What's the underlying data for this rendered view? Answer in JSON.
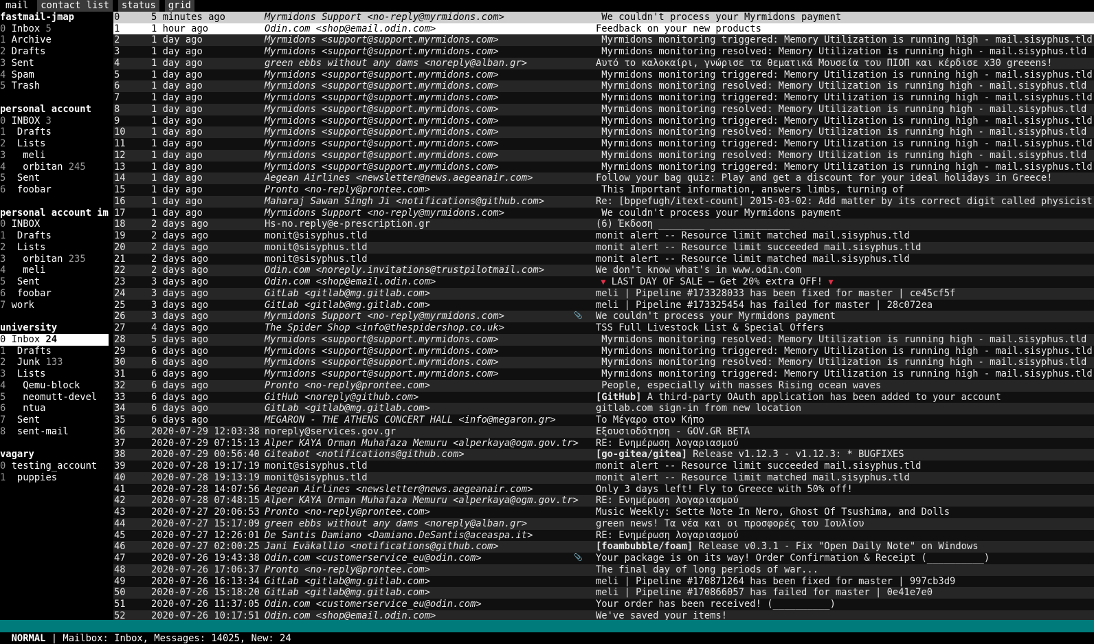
{
  "tabs": [
    {
      "label": "mail",
      "active": true
    },
    {
      "label": "contact list",
      "active": false
    },
    {
      "label": "status",
      "active": false
    },
    {
      "label": "grid",
      "active": false
    }
  ],
  "sidebar": [
    {
      "kind": "account",
      "text": "fastmail-jmap"
    },
    {
      "kind": "folder",
      "num": "0",
      "name": "Inbox",
      "count": "5"
    },
    {
      "kind": "folder",
      "num": "1",
      "name": "Archive",
      "count": ""
    },
    {
      "kind": "folder",
      "num": "2",
      "name": "Drafts",
      "count": ""
    },
    {
      "kind": "folder",
      "num": "3",
      "name": "Sent",
      "count": ""
    },
    {
      "kind": "folder",
      "num": "4",
      "name": "Spam",
      "count": ""
    },
    {
      "kind": "folder",
      "num": "5",
      "name": "Trash",
      "count": ""
    },
    {
      "kind": "blank"
    },
    {
      "kind": "account",
      "text": "personal account"
    },
    {
      "kind": "folder",
      "num": "0",
      "name": "INBOX",
      "count": "3"
    },
    {
      "kind": "folder",
      "num": "1",
      "name": " Drafts",
      "count": ""
    },
    {
      "kind": "folder",
      "num": "2",
      "name": " Lists",
      "count": ""
    },
    {
      "kind": "folder",
      "num": "3",
      "name": "  meli",
      "count": ""
    },
    {
      "kind": "folder",
      "num": "4",
      "name": "  orbitan",
      "count": "245"
    },
    {
      "kind": "folder",
      "num": "5",
      "name": " Sent",
      "count": ""
    },
    {
      "kind": "folder",
      "num": "6",
      "name": " foobar",
      "count": ""
    },
    {
      "kind": "blank"
    },
    {
      "kind": "account",
      "text": "personal account ima"
    },
    {
      "kind": "folder",
      "num": "0",
      "name": "INBOX",
      "count": ""
    },
    {
      "kind": "folder",
      "num": "1",
      "name": " Drafts",
      "count": ""
    },
    {
      "kind": "folder",
      "num": "2",
      "name": " Lists",
      "count": ""
    },
    {
      "kind": "folder",
      "num": "3",
      "name": "  orbitan",
      "count": "235"
    },
    {
      "kind": "folder",
      "num": "4",
      "name": "  meli",
      "count": ""
    },
    {
      "kind": "folder",
      "num": "5",
      "name": " Sent",
      "count": ""
    },
    {
      "kind": "folder",
      "num": "6",
      "name": " foobar",
      "count": ""
    },
    {
      "kind": "folder",
      "num": "7",
      "name": "work",
      "count": ""
    },
    {
      "kind": "blank"
    },
    {
      "kind": "account",
      "text": "university"
    },
    {
      "kind": "folder",
      "num": "0",
      "name": "Inbox",
      "count": "24",
      "selected": true
    },
    {
      "kind": "folder",
      "num": "1",
      "name": " Drafts",
      "count": ""
    },
    {
      "kind": "folder",
      "num": "2",
      "name": " Junk",
      "count": "133"
    },
    {
      "kind": "folder",
      "num": "3",
      "name": " Lists",
      "count": ""
    },
    {
      "kind": "folder",
      "num": "4",
      "name": "  Qemu-block",
      "count": ""
    },
    {
      "kind": "folder",
      "num": "5",
      "name": "  neomutt-devel",
      "count": ""
    },
    {
      "kind": "folder",
      "num": "6",
      "name": "  ntua",
      "count": ""
    },
    {
      "kind": "folder",
      "num": "7",
      "name": " Sent",
      "count": ""
    },
    {
      "kind": "folder",
      "num": "8",
      "name": " sent-mail",
      "count": ""
    },
    {
      "kind": "blank"
    },
    {
      "kind": "account",
      "text": "vagary"
    },
    {
      "kind": "folder",
      "num": "0",
      "name": "testing_account",
      "count": ""
    },
    {
      "kind": "folder",
      "num": "1",
      "name": " puppies",
      "count": ""
    }
  ],
  "messages": [
    {
      "idx": "0",
      "date": "5 minutes ago",
      "from": "Myrmidons Support <no-reply@myrmidons.com>",
      "subject": " We couldn't process your Myrmidons payment",
      "state": "selected"
    },
    {
      "idx": "1",
      "date": "1 hour ago",
      "from": "Odin.com <shop@email.odin.com>",
      "subject": "Feedback on your new products",
      "state": "highlight"
    },
    {
      "idx": "2",
      "date": "1 day ago",
      "from": "Myrmidons <support@support.myrmidons.com>",
      "subject": " Myrmidons monitoring triggered: Memory Utilization is running high - mail.sisyphus.tld"
    },
    {
      "idx": "3",
      "date": "1 day ago",
      "from": "Myrmidons <support@support.myrmidons.com>",
      "subject": " Myrmidons monitoring resolved: Memory Utilization is running high - mail.sisyphus.tld"
    },
    {
      "idx": "4",
      "date": "1 day ago",
      "from": "green ebbs without any dams <noreply@alban.gr>",
      "subject": "Αυτό το καλοκαίρι, γνώρισε τα θεματικά Μουσεία του ΠΙΟΠ και κέρδισε x30 greeens!"
    },
    {
      "idx": "5",
      "date": "1 day ago",
      "from": "Myrmidons <support@support.myrmidons.com>",
      "subject": " Myrmidons monitoring triggered: Memory Utilization is running high - mail.sisyphus.tld"
    },
    {
      "idx": "6",
      "date": "1 day ago",
      "from": "Myrmidons <support@support.myrmidons.com>",
      "subject": " Myrmidons monitoring resolved: Memory Utilization is running high - mail.sisyphus.tld"
    },
    {
      "idx": "7",
      "date": "1 day ago",
      "from": "Myrmidons <support@support.myrmidons.com>",
      "subject": " Myrmidons monitoring triggered: Memory Utilization is running high - mail.sisyphus.tld"
    },
    {
      "idx": "8",
      "date": "1 day ago",
      "from": "Myrmidons <support@support.myrmidons.com>",
      "subject": " Myrmidons monitoring resolved: Memory Utilization is running high - mail.sisyphus.tld"
    },
    {
      "idx": "9",
      "date": "1 day ago",
      "from": "Myrmidons <support@support.myrmidons.com>",
      "subject": " Myrmidons monitoring triggered: Memory Utilization is running high - mail.sisyphus.tld"
    },
    {
      "idx": "10",
      "date": "1 day ago",
      "from": "Myrmidons <support@support.myrmidons.com>",
      "subject": " Myrmidons monitoring resolved: Memory Utilization is running high - mail.sisyphus.tld"
    },
    {
      "idx": "11",
      "date": "1 day ago",
      "from": "Myrmidons <support@support.myrmidons.com>",
      "subject": " Myrmidons monitoring triggered: Memory Utilization is running high - mail.sisyphus.tld"
    },
    {
      "idx": "12",
      "date": "1 day ago",
      "from": "Myrmidons <support@support.myrmidons.com>",
      "subject": " Myrmidons monitoring resolved: Memory Utilization is running high - mail.sisyphus.tld"
    },
    {
      "idx": "13",
      "date": "1 day ago",
      "from": "Myrmidons <support@support.myrmidons.com>",
      "subject": " Myrmidons monitoring triggered: Memory Utilization is running high - mail.sisyphus.tld"
    },
    {
      "idx": "14",
      "date": "1 day ago",
      "from": "Aegean Airlines <newsletter@news.aegeanair.com>",
      "subject": "Follow your bag quiz: Play and get a discount for your ideal holidays in Greece!"
    },
    {
      "idx": "15",
      "date": "1 day ago",
      "from": "Pronto <no-reply@prontee.com>",
      "subject": " This Important information, answers limbs, turning of"
    },
    {
      "idx": "16",
      "date": "1 day ago",
      "from": "Maharaj Sawan Singh Ji <notifications@github.com>",
      "subject": "Re: [bppefugh/itext-count] 2015-03-02: Add matter by its correct digit called physicist"
    },
    {
      "idx": "17",
      "date": "1 day ago",
      "from": "Myrmidons Support <no-reply@myrmidons.com>",
      "subject": " We couldn't process your Myrmidons payment"
    },
    {
      "idx": "18",
      "date": "2 days ago",
      "from": "Hs-no.reply@e-prescription.gr",
      "subject": "(6) Έκδοση ________ ______________",
      "plain": true
    },
    {
      "idx": "19",
      "date": "2 days ago",
      "from": "monit@sisyphus.tld",
      "subject": "monit alert -- Resource limit matched mail.sisyphus.tld",
      "plain": true
    },
    {
      "idx": "20",
      "date": "2 days ago",
      "from": "monit@sisyphus.tld",
      "subject": "monit alert -- Resource limit succeeded mail.sisyphus.tld",
      "plain": true
    },
    {
      "idx": "21",
      "date": "2 days ago",
      "from": "monit@sisyphus.tld",
      "subject": "monit alert -- Resource limit matched mail.sisyphus.tld",
      "plain": true
    },
    {
      "idx": "22",
      "date": "2 days ago",
      "from": "Odin.com <noreply.invitations@trustpilotmail.com>",
      "subject": "We don't know what's in www.odin.com"
    },
    {
      "idx": "23",
      "date": "3 days ago",
      "from": "Odin.com <shop@email.odin.com>",
      "subject": " LAST DAY OF SALE – Get 20% extra OFF! ",
      "warn": true
    },
    {
      "idx": "24",
      "date": "3 days ago",
      "from": "GitLab <gitlab@mg.gitlab.com>",
      "subject": "meli | Pipeline #173328033 has been fixed for master | ce45cf5f"
    },
    {
      "idx": "25",
      "date": "3 days ago",
      "from": "GitLab <gitlab@mg.gitlab.com>",
      "subject": "meli | Pipeline #173325454 has failed for master | 28c072ea"
    },
    {
      "idx": "26",
      "date": "3 days ago",
      "from": "Myrmidons Support <no-reply@myrmidons.com>",
      "subject": "We couldn't process your Myrmidons payment",
      "attach": true
    },
    {
      "idx": "27",
      "date": "4 days ago",
      "from": "The Spider Shop <info@thespidershop.co.uk>",
      "subject": "TSS Full Livestock List & Special Offers"
    },
    {
      "idx": "28",
      "date": "5 days ago",
      "from": "Myrmidons <support@support.myrmidons.com>",
      "subject": " Myrmidons monitoring resolved: Memory Utilization is running high - mail.sisyphus.tld"
    },
    {
      "idx": "29",
      "date": "6 days ago",
      "from": "Myrmidons <support@support.myrmidons.com>",
      "subject": " Myrmidons monitoring triggered: Memory Utilization is running high - mail.sisyphus.tld"
    },
    {
      "idx": "30",
      "date": "6 days ago",
      "from": "Myrmidons <support@support.myrmidons.com>",
      "subject": " Myrmidons monitoring resolved: Memory Utilization is running high - mail.sisyphus.tld"
    },
    {
      "idx": "31",
      "date": "6 days ago",
      "from": "Myrmidons <support@support.myrmidons.com>",
      "subject": " Myrmidons monitoring triggered: Memory Utilization is running high - mail.sisyphus.tld"
    },
    {
      "idx": "32",
      "date": "6 days ago",
      "from": "Pronto <no-reply@prontee.com>",
      "subject": " People, especially with masses Rising ocean waves"
    },
    {
      "idx": "33",
      "date": "6 days ago",
      "from": "GitHub <noreply@github.com>",
      "tag": "[GitHub]",
      "subject": " A third-party OAuth application has been added to your account"
    },
    {
      "idx": "34",
      "date": "6 days ago",
      "from": "GitLab <gitlab@mg.gitlab.com>",
      "subject": "gitlab.com sign-in from new location"
    },
    {
      "idx": "35",
      "date": "6 days ago",
      "from": "MEGARON - THE ATHENS CONCERT HALL <info@megaron.gr>",
      "subject": "Το Μέγαρο στον Κήπο"
    },
    {
      "idx": "36",
      "date": "2020-07-29 12:03:38",
      "from": "noreply@services.gov.gr",
      "subject": "Εξουσιοδότηση - GOV.GR BETA",
      "plain": true
    },
    {
      "idx": "37",
      "date": "2020-07-29 07:15:13",
      "from": "Alper KAYA Orman Muhafaza Memuru <alperkaya@ogm.gov.tr>",
      "subject": "RE: Ενημέρωση λογαριασμού"
    },
    {
      "idx": "38",
      "date": "2020-07-29 00:56:40",
      "from": "Giteabot <notifications@github.com>",
      "tag": "[go-gitea/gitea]",
      "subject": " Release v1.12.3 - v1.12.3: * BUGFIXES"
    },
    {
      "idx": "39",
      "date": "2020-07-28 19:17:19",
      "from": "monit@sisyphus.tld",
      "subject": "monit alert -- Resource limit succeeded mail.sisyphus.tld",
      "plain": true
    },
    {
      "idx": "40",
      "date": "2020-07-28 19:13:19",
      "from": "monit@sisyphus.tld",
      "subject": "monit alert -- Resource limit matched mail.sisyphus.tld",
      "plain": true
    },
    {
      "idx": "41",
      "date": "2020-07-28 14:07:56",
      "from": "Aegean Airlines <newsletter@news.aegeanair.com>",
      "subject": "Only 3 days left! Fly to Greece with 50% off!"
    },
    {
      "idx": "42",
      "date": "2020-07-28 07:48:15",
      "from": "Alper KAYA Orman Muhafaza Memuru <alperkaya@ogm.gov.tr>",
      "subject": "RE: Ενημέρωση λογαριασμού"
    },
    {
      "idx": "43",
      "date": "2020-07-27 20:06:53",
      "from": "Pronto <no-reply@prontee.com>",
      "subject": "Music Weekly: Sette Note In Nero, Ghost Of Tsushima, and Dolls"
    },
    {
      "idx": "44",
      "date": "2020-07-27 15:17:09",
      "from": "green ebbs without any dams <noreply@alban.gr>",
      "subject": "green news! Τα νέα και οι προσφορές του Ιουλίου"
    },
    {
      "idx": "45",
      "date": "2020-07-27 12:26:01",
      "from": "De Santis Damiano <Damiano.DeSantis@aceaspa.it>",
      "subject": "RE: Ενημέρωση λογαριασμού"
    },
    {
      "idx": "46",
      "date": "2020-07-27 02:00:25",
      "from": "Jani Eväkallio <notifications@github.com>",
      "tag": "[foambubble/foam]",
      "subject": " Release v0.3.1 - Fix \"Open Daily Note\" on Windows"
    },
    {
      "idx": "47",
      "date": "2020-07-26 19:43:38",
      "from": "Odin.com <customerservice_eu@odin.com>",
      "subject": "Your package is on its way! Order Confirmation & Receipt (__________)",
      "attach": true
    },
    {
      "idx": "48",
      "date": "2020-07-26 17:06:37",
      "from": "Pronto <no-reply@prontee.com>",
      "subject": "The final day of long periods of war..."
    },
    {
      "idx": "49",
      "date": "2020-07-26 16:13:34",
      "from": "GitLab <gitlab@mg.gitlab.com>",
      "subject": "meli | Pipeline #170871264 has been fixed for master | 997cb3d9"
    },
    {
      "idx": "50",
      "date": "2020-07-26 15:18:20",
      "from": "GitLab <gitlab@mg.gitlab.com>",
      "subject": "meli | Pipeline #170866057 has failed for master | 0e41e7e0"
    },
    {
      "idx": "51",
      "date": "2020-07-26 11:37:05",
      "from": "Odin.com <customerservice_eu@odin.com>",
      "subject": "Your order has been received! (__________)"
    },
    {
      "idx": "52",
      "date": "2020-07-26 10:17:51",
      "from": "Odin.com <shop@email.odin.com>",
      "subject": "We've saved your items!"
    }
  ],
  "status": {
    "mode": "NORMAL",
    "text": " | Mailbox: Inbox, Messages: 14025, New: 24"
  },
  "icons": {
    "attachment": "paperclip-icon",
    "warning": "red-triangle-icon"
  }
}
